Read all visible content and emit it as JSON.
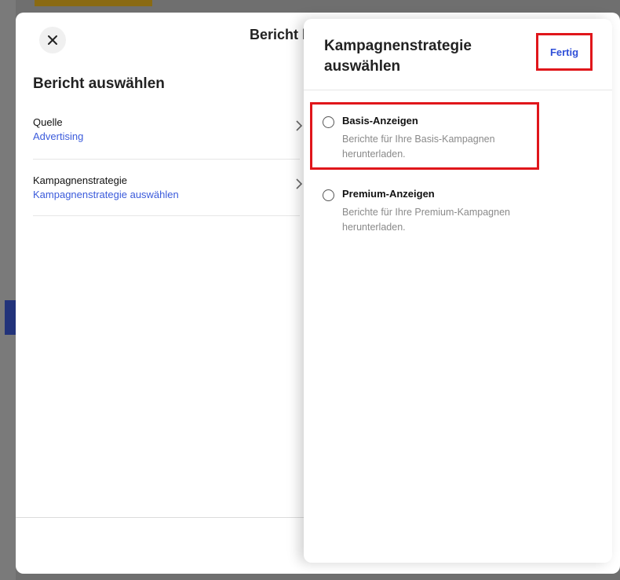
{
  "dialog": {
    "title": "Bericht herunterladen",
    "left_title": "Bericht auswählen",
    "rows": [
      {
        "label": "Quelle",
        "value": "Advertising"
      },
      {
        "label": "Kampagnenstrategie",
        "value": "Kampagnenstrategie auswählen"
      }
    ]
  },
  "panel": {
    "title": "Kampagnenstrategie auswählen",
    "done_label": "Fertig",
    "options": [
      {
        "title": "Basis-Anzeigen",
        "description": "Berichte für Ihre Basis-Kampagnen herunterladen.",
        "selected": false
      },
      {
        "title": "Premium-Anzeigen",
        "description": "Berichte für Ihre Premium-Kampagnen herunterladen.",
        "selected": false
      }
    ]
  },
  "icons": {
    "close": "close-icon",
    "chevron": "chevron-right-icon"
  },
  "colors": {
    "link": "#3b5bdb",
    "highlight": "#e0161b"
  }
}
